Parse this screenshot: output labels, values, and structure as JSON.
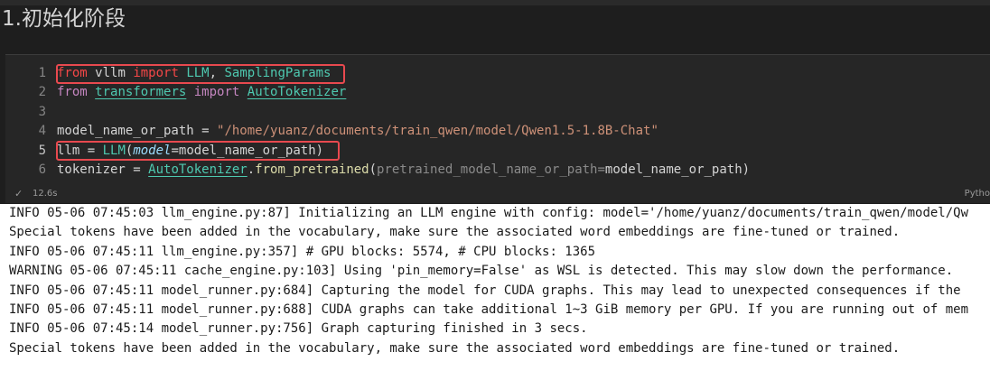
{
  "heading": "1.初始化阶段",
  "cell": {
    "lines": [
      {
        "num": "1",
        "tokens": [
          {
            "t": "from",
            "c": "kw2"
          },
          {
            "t": " ",
            "c": "op"
          },
          {
            "t": "vllm",
            "c": "op"
          },
          {
            "t": " ",
            "c": "op"
          },
          {
            "t": "import",
            "c": "kw2"
          },
          {
            "t": " ",
            "c": "op"
          },
          {
            "t": "LLM",
            "c": "cls"
          },
          {
            "t": ", ",
            "c": "op"
          },
          {
            "t": "SamplingParams",
            "c": "cls"
          }
        ]
      },
      {
        "num": "2",
        "tokens": [
          {
            "t": "from",
            "c": "kw"
          },
          {
            "t": " ",
            "c": "op"
          },
          {
            "t": "transformers",
            "c": "mod"
          },
          {
            "t": " ",
            "c": "op"
          },
          {
            "t": "import",
            "c": "kw"
          },
          {
            "t": " ",
            "c": "op"
          },
          {
            "t": "AutoTokenizer",
            "c": "mod"
          }
        ]
      },
      {
        "num": "3",
        "tokens": []
      },
      {
        "num": "4",
        "tokens": [
          {
            "t": "model_name_or_path",
            "c": "op"
          },
          {
            "t": " = ",
            "c": "op"
          },
          {
            "t": "\"/home/yuanz/documents/train_qwen/model/Qwen1.5-1.8B-Chat\"",
            "c": "str"
          }
        ]
      },
      {
        "num": "5",
        "tokens": [
          {
            "t": "llm",
            "c": "op"
          },
          {
            "t": " = ",
            "c": "op"
          },
          {
            "t": "LLM",
            "c": "cls"
          },
          {
            "t": "(",
            "c": "op"
          },
          {
            "t": "model",
            "c": "param"
          },
          {
            "t": "=",
            "c": "op"
          },
          {
            "t": "model_name_or_path",
            "c": "op"
          },
          {
            "t": ")",
            "c": "op"
          }
        ]
      },
      {
        "num": "6",
        "tokens": [
          {
            "t": "tokenizer",
            "c": "op"
          },
          {
            "t": " = ",
            "c": "op"
          },
          {
            "t": "AutoTokenizer",
            "c": "mod"
          },
          {
            "t": ".",
            "c": "op"
          },
          {
            "t": "from_pretrained",
            "c": "fn"
          },
          {
            "t": "(",
            "c": "op"
          },
          {
            "t": "pretrained_model_name_or_path=",
            "c": "hint"
          },
          {
            "t": "model_name_or_path",
            "c": "op"
          },
          {
            "t": ")",
            "c": "op"
          }
        ]
      }
    ],
    "status": {
      "check": "✓",
      "time": "12.6s",
      "language": "Pytho"
    }
  },
  "output": {
    "lines": [
      "INFO 05-06 07:45:03 llm_engine.py:87] Initializing an LLM engine with config: model='/home/yuanz/documents/train_qwen/model/Qw",
      "Special tokens have been added in the vocabulary, make sure the associated word embeddings are fine-tuned or trained.",
      "INFO 05-06 07:45:11 llm_engine.py:357] # GPU blocks: 5574, # CPU blocks: 1365",
      "WARNING 05-06 07:45:11 cache_engine.py:103] Using 'pin_memory=False' as WSL is detected. This may slow down the performance.",
      "INFO 05-06 07:45:11 model_runner.py:684] Capturing the model for CUDA graphs. This may lead to unexpected consequences if the",
      "INFO 05-06 07:45:11 model_runner.py:688] CUDA graphs can take additional 1~3 GiB memory per GPU. If you are running out of mem",
      "INFO 05-06 07:45:14 model_runner.py:756] Graph capturing finished in 3 secs.",
      "Special tokens have been added in the vocabulary, make sure the associated word embeddings are fine-tuned or trained."
    ]
  },
  "colors": {
    "highlight": "#e8494f",
    "editor_bg": "#262626",
    "output_bg": "#ffffff"
  }
}
